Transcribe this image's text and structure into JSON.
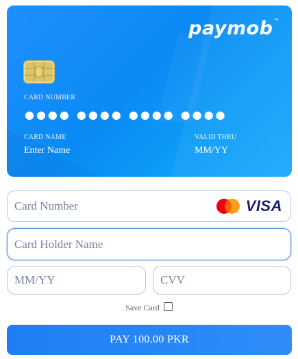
{
  "card": {
    "brand": "paymob",
    "brand_mark": "™",
    "number_label": "CARD NUMBER",
    "number_value": "●●●●  ●●●●  ●●●●  ●●●●",
    "name_label": "CARD NAME",
    "name_value": "Enter Name",
    "valid_label": "VALID THRU",
    "valid_value": "MM/YY"
  },
  "form": {
    "card_number_placeholder": "Card Number",
    "card_holder_placeholder": "Card Holder Name",
    "expiry_placeholder": "MM/YY",
    "cvv_placeholder": "CVV",
    "visa_label": "VISA",
    "save_card_label": "Save Card",
    "pay_label": "PAY 100.00 PKR"
  },
  "icons": [
    "chip-icon",
    "mastercard-icon",
    "visa-icon",
    "checkbox-icon"
  ],
  "colors": {
    "card_gradient_start": "#1f8fff",
    "card_gradient_end": "#1aa8fb",
    "pay_button": "#2286f8",
    "field_border": "#b7c6e6",
    "mastercard_red": "#eb001b",
    "mastercard_orange": "#f79e1b",
    "visa_blue": "#1a1f71"
  }
}
